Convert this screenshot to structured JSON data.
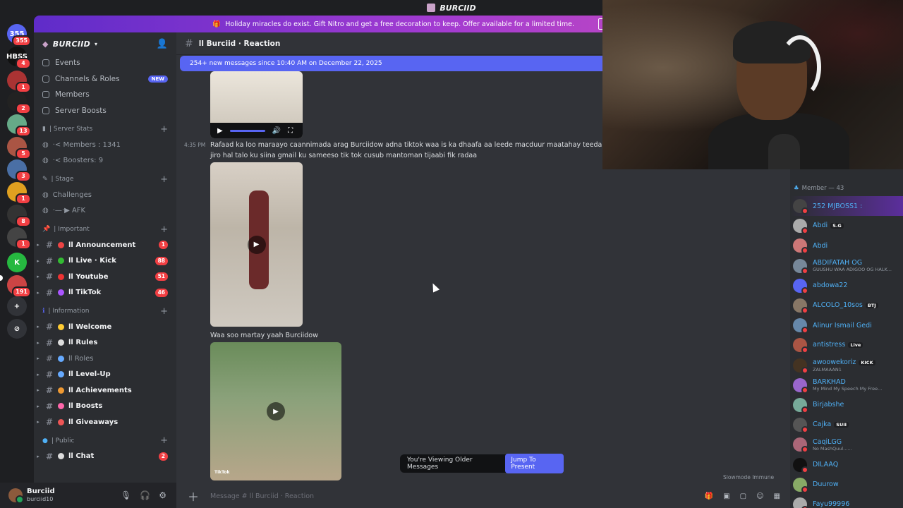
{
  "titlebar": {
    "title": "BURCIID"
  },
  "guilds": [
    {
      "label": "355",
      "color": "#5865f2",
      "badge": "355"
    },
    {
      "label": "HBSS",
      "color": "#111",
      "badge": "4"
    },
    {
      "label": "",
      "color": "#a33",
      "badge": "1"
    },
    {
      "label": "",
      "color": "#222",
      "badge": "2"
    },
    {
      "label": "",
      "color": "#6a8",
      "badge": "13"
    },
    {
      "label": "",
      "color": "#a54",
      "badge": "5"
    },
    {
      "label": "",
      "color": "#4a6fa5",
      "badge": "3"
    },
    {
      "label": "",
      "color": "#e0a020",
      "badge": "1"
    },
    {
      "label": "",
      "color": "#333",
      "badge": "8"
    },
    {
      "label": "",
      "color": "#444",
      "badge": "1"
    },
    {
      "label": "K",
      "color": "#26b840",
      "badge": ""
    },
    {
      "label": "",
      "color": "#c44",
      "badge": "191"
    }
  ],
  "banner": {
    "text": "Holiday miracles do exist. Gift Nitro and get a free decoration to keep. Offer available for a limited time."
  },
  "server": {
    "name": "BURCIID",
    "nav": [
      {
        "label": "Events",
        "badge": ""
      },
      {
        "label": "Channels & Roles",
        "badge": "NEW"
      },
      {
        "label": "Members",
        "badge": ""
      },
      {
        "label": "Server Boosts",
        "badge": ""
      }
    ],
    "cat_stats": "| Server Stats",
    "stats": [
      "·< Members : 1341",
      "·< Boosters: 9"
    ],
    "cat_stage": "| Stage",
    "stage": [
      "Challenges",
      "·—·▶ AFK"
    ],
    "cat_important": "| Important",
    "important": [
      {
        "label": "ll Announcement",
        "count": "1",
        "dot": "#e44"
      },
      {
        "label": "ll Live · Kick",
        "count": "88",
        "dot": "#3b3"
      },
      {
        "label": "ll Youtube",
        "count": "51",
        "dot": "#e33"
      },
      {
        "label": "ll TikTok",
        "count": "46",
        "dot": "#a5f"
      }
    ],
    "cat_info": "| Information",
    "info": [
      {
        "label": "ll Welcome",
        "unread": true,
        "dot": "#fc3"
      },
      {
        "label": "ll Rules",
        "unread": true,
        "dot": "#ddd"
      },
      {
        "label": "ll Roles",
        "unread": false,
        "dot": "#6af"
      },
      {
        "label": "ll Level-Up",
        "unread": true,
        "dot": "#6af"
      },
      {
        "label": "ll Achievements",
        "unread": true,
        "dot": "#e93"
      },
      {
        "label": "ll Boosts",
        "unread": true,
        "dot": "#f6a"
      },
      {
        "label": "ll Giveaways",
        "unread": true,
        "dot": "#e55"
      }
    ],
    "cat_public": "| Public",
    "public": [
      {
        "label": "ll Chat",
        "count": "2",
        "dot": "#ddd"
      }
    ]
  },
  "user": {
    "name": "Burciid",
    "status": "burciid10"
  },
  "channel": {
    "title": "ll Burciid · Reaction"
  },
  "newbar": "254+ new messages since 10:40 AM on December 22, 2025",
  "messages": {
    "time": "4:35 PM",
    "line1": "Rafaad ka loo maraayo caannimada arag Burciidow adna tiktok waa is ka dhaafa aa leede macduur maatahay teeda kale nic",
    "line2": "jiro hal talo ku siina gmail ku sameeso tik tok cusub mantoman tijaabi fik radaa",
    "caption2": "Waa soo martay yaah Burciidow",
    "tiktok": "TikTok"
  },
  "older": {
    "text": "You're Viewing Older Messages",
    "button": "Jump To Present"
  },
  "slowmode": "Slowmode Immune",
  "composer": {
    "placeholder": "Message # ll Burciid · Reaction"
  },
  "members_cat": "Member — 43",
  "members": [
    {
      "name": "252 MJBOSS1 :",
      "sub": "",
      "tag": "",
      "color": "#444",
      "hl": true
    },
    {
      "name": "Abdi",
      "sub": "",
      "tag": "S.G",
      "color": "#aaa"
    },
    {
      "name": "Abdi",
      "sub": "",
      "tag": "",
      "color": "#c77"
    },
    {
      "name": "ABDIFATAH OG",
      "sub": "GUUSHU WAA ADIGOO OG HALK...",
      "tag": "",
      "color": "#789"
    },
    {
      "name": "abdowa22",
      "sub": "",
      "tag": "",
      "color": "#5865f2"
    },
    {
      "name": "ALCOLO_10sos",
      "sub": "",
      "tag": "BTJ",
      "color": "#876"
    },
    {
      "name": "Alinur Ismail Gedi",
      "sub": "",
      "tag": "",
      "color": "#68a"
    },
    {
      "name": "antistress",
      "sub": "",
      "tag": "Live",
      "color": "#a54"
    },
    {
      "name": "awoowekoriz",
      "sub": "ZALMAAAN1",
      "tag": "KICK",
      "color": "#432"
    },
    {
      "name": "BARKHAD",
      "sub": "My Mind My Speech My Free...",
      "tag": "",
      "color": "#96c"
    },
    {
      "name": "Birjabshe",
      "sub": "",
      "tag": "",
      "color": "#7a9"
    },
    {
      "name": "Cajka",
      "sub": "",
      "tag": "SUII",
      "color": "#555"
    },
    {
      "name": "CaqiLGG",
      "sub": "No MashQuul......",
      "tag": "",
      "color": "#a67"
    },
    {
      "name": "DILAAQ",
      "sub": "",
      "tag": "",
      "color": "#111"
    },
    {
      "name": "Duurow",
      "sub": "",
      "tag": "",
      "color": "#8a6"
    },
    {
      "name": "Fayu99996",
      "sub": "",
      "tag": "",
      "color": "#aaa"
    }
  ]
}
